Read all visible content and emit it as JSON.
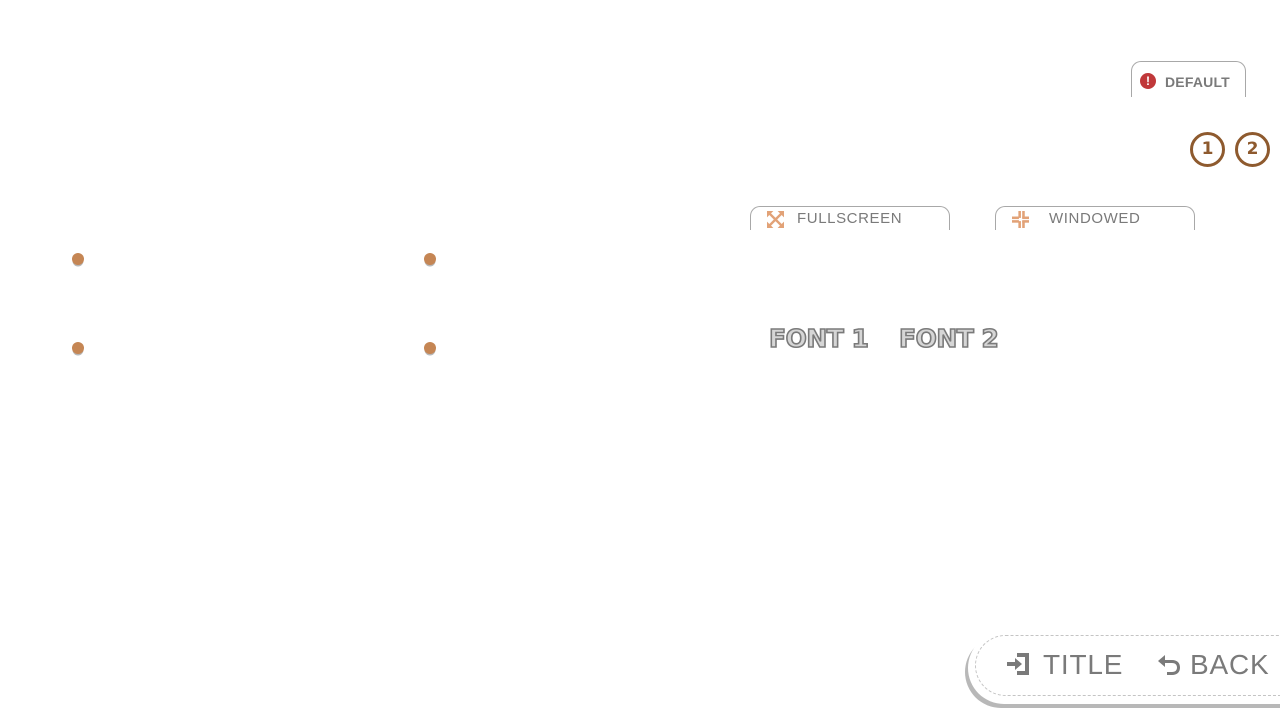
{
  "reset": {
    "label": "DEFAULT",
    "icon": "exclamation-icon",
    "icon_color": "#c0383a"
  },
  "pages": {
    "items": [
      "1",
      "2"
    ],
    "accent": "#8e5a2e"
  },
  "display_mode": {
    "fullscreen_label": "FULLSCREEN",
    "fullscreen_icon": "expand-arrows-icon",
    "windowed_label": "WINDOWED",
    "windowed_icon": "compress-arrows-icon",
    "icon_color": "#e2a277"
  },
  "fonts": {
    "font1_label": "FONT 1",
    "font2_label": "FONT 2"
  },
  "options": {
    "dot_color": "#c58654"
  },
  "navigation": {
    "title_label": "TITLE",
    "title_icon": "exit-door-icon",
    "back_label": "BACK",
    "back_icon": "undo-arrow-icon"
  }
}
